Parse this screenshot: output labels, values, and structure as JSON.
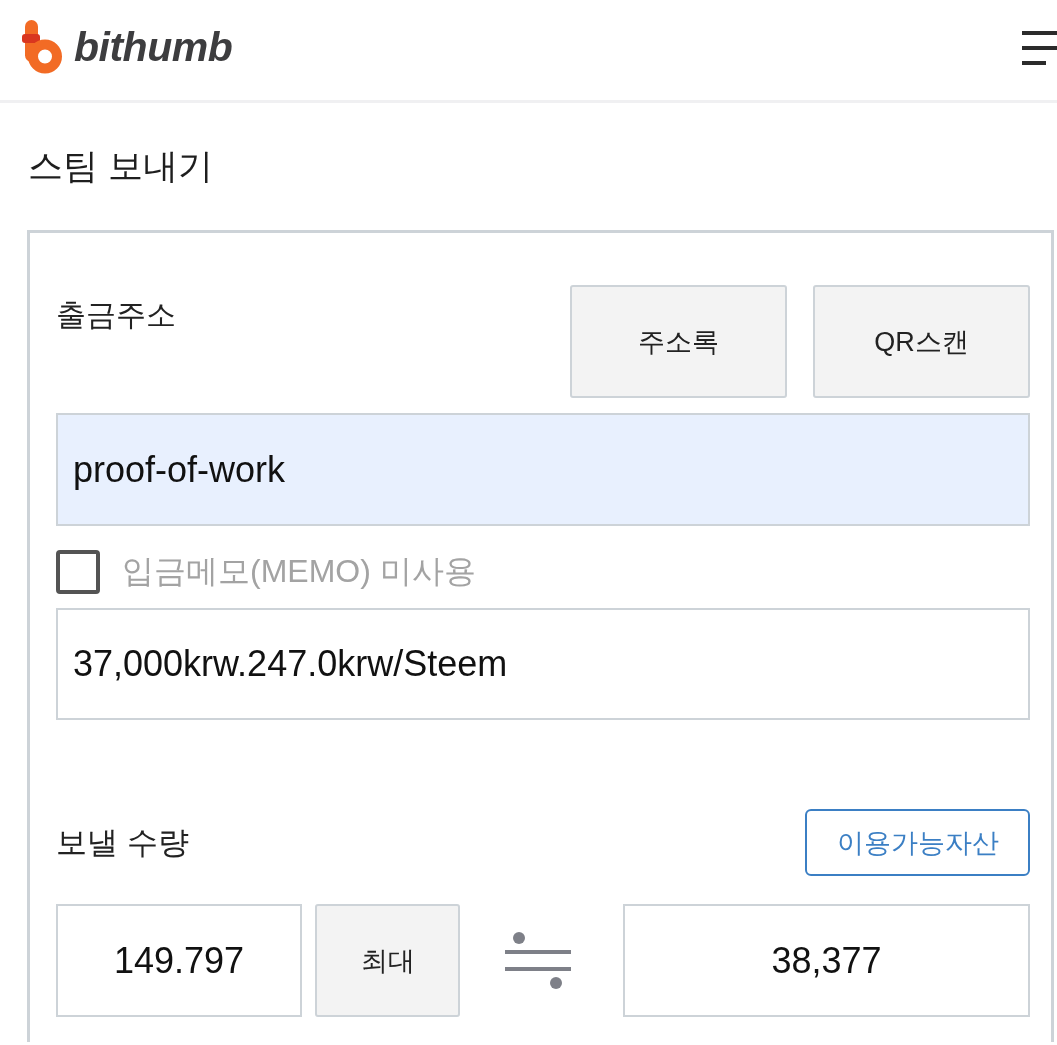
{
  "header": {
    "logo": {
      "wordmark": "bithumb"
    }
  },
  "title": "스팀 보내기",
  "address": {
    "label": "출금주소",
    "buttons": [
      {
        "label": "주소록"
      },
      {
        "label": "QR스캔"
      }
    ],
    "value": "proof-of-work",
    "autofilled": true
  },
  "memo_option": {
    "label": "입금메모(MEMO) 미사용",
    "checked": false
  },
  "memo": {
    "value": "37,000krw.247.0krw/Steem"
  },
  "amount": {
    "label": "보낼 수량",
    "assets_button": "이용가능자산",
    "quantity": "149.797",
    "max_button": "최대",
    "krw_value": "38,377"
  }
}
